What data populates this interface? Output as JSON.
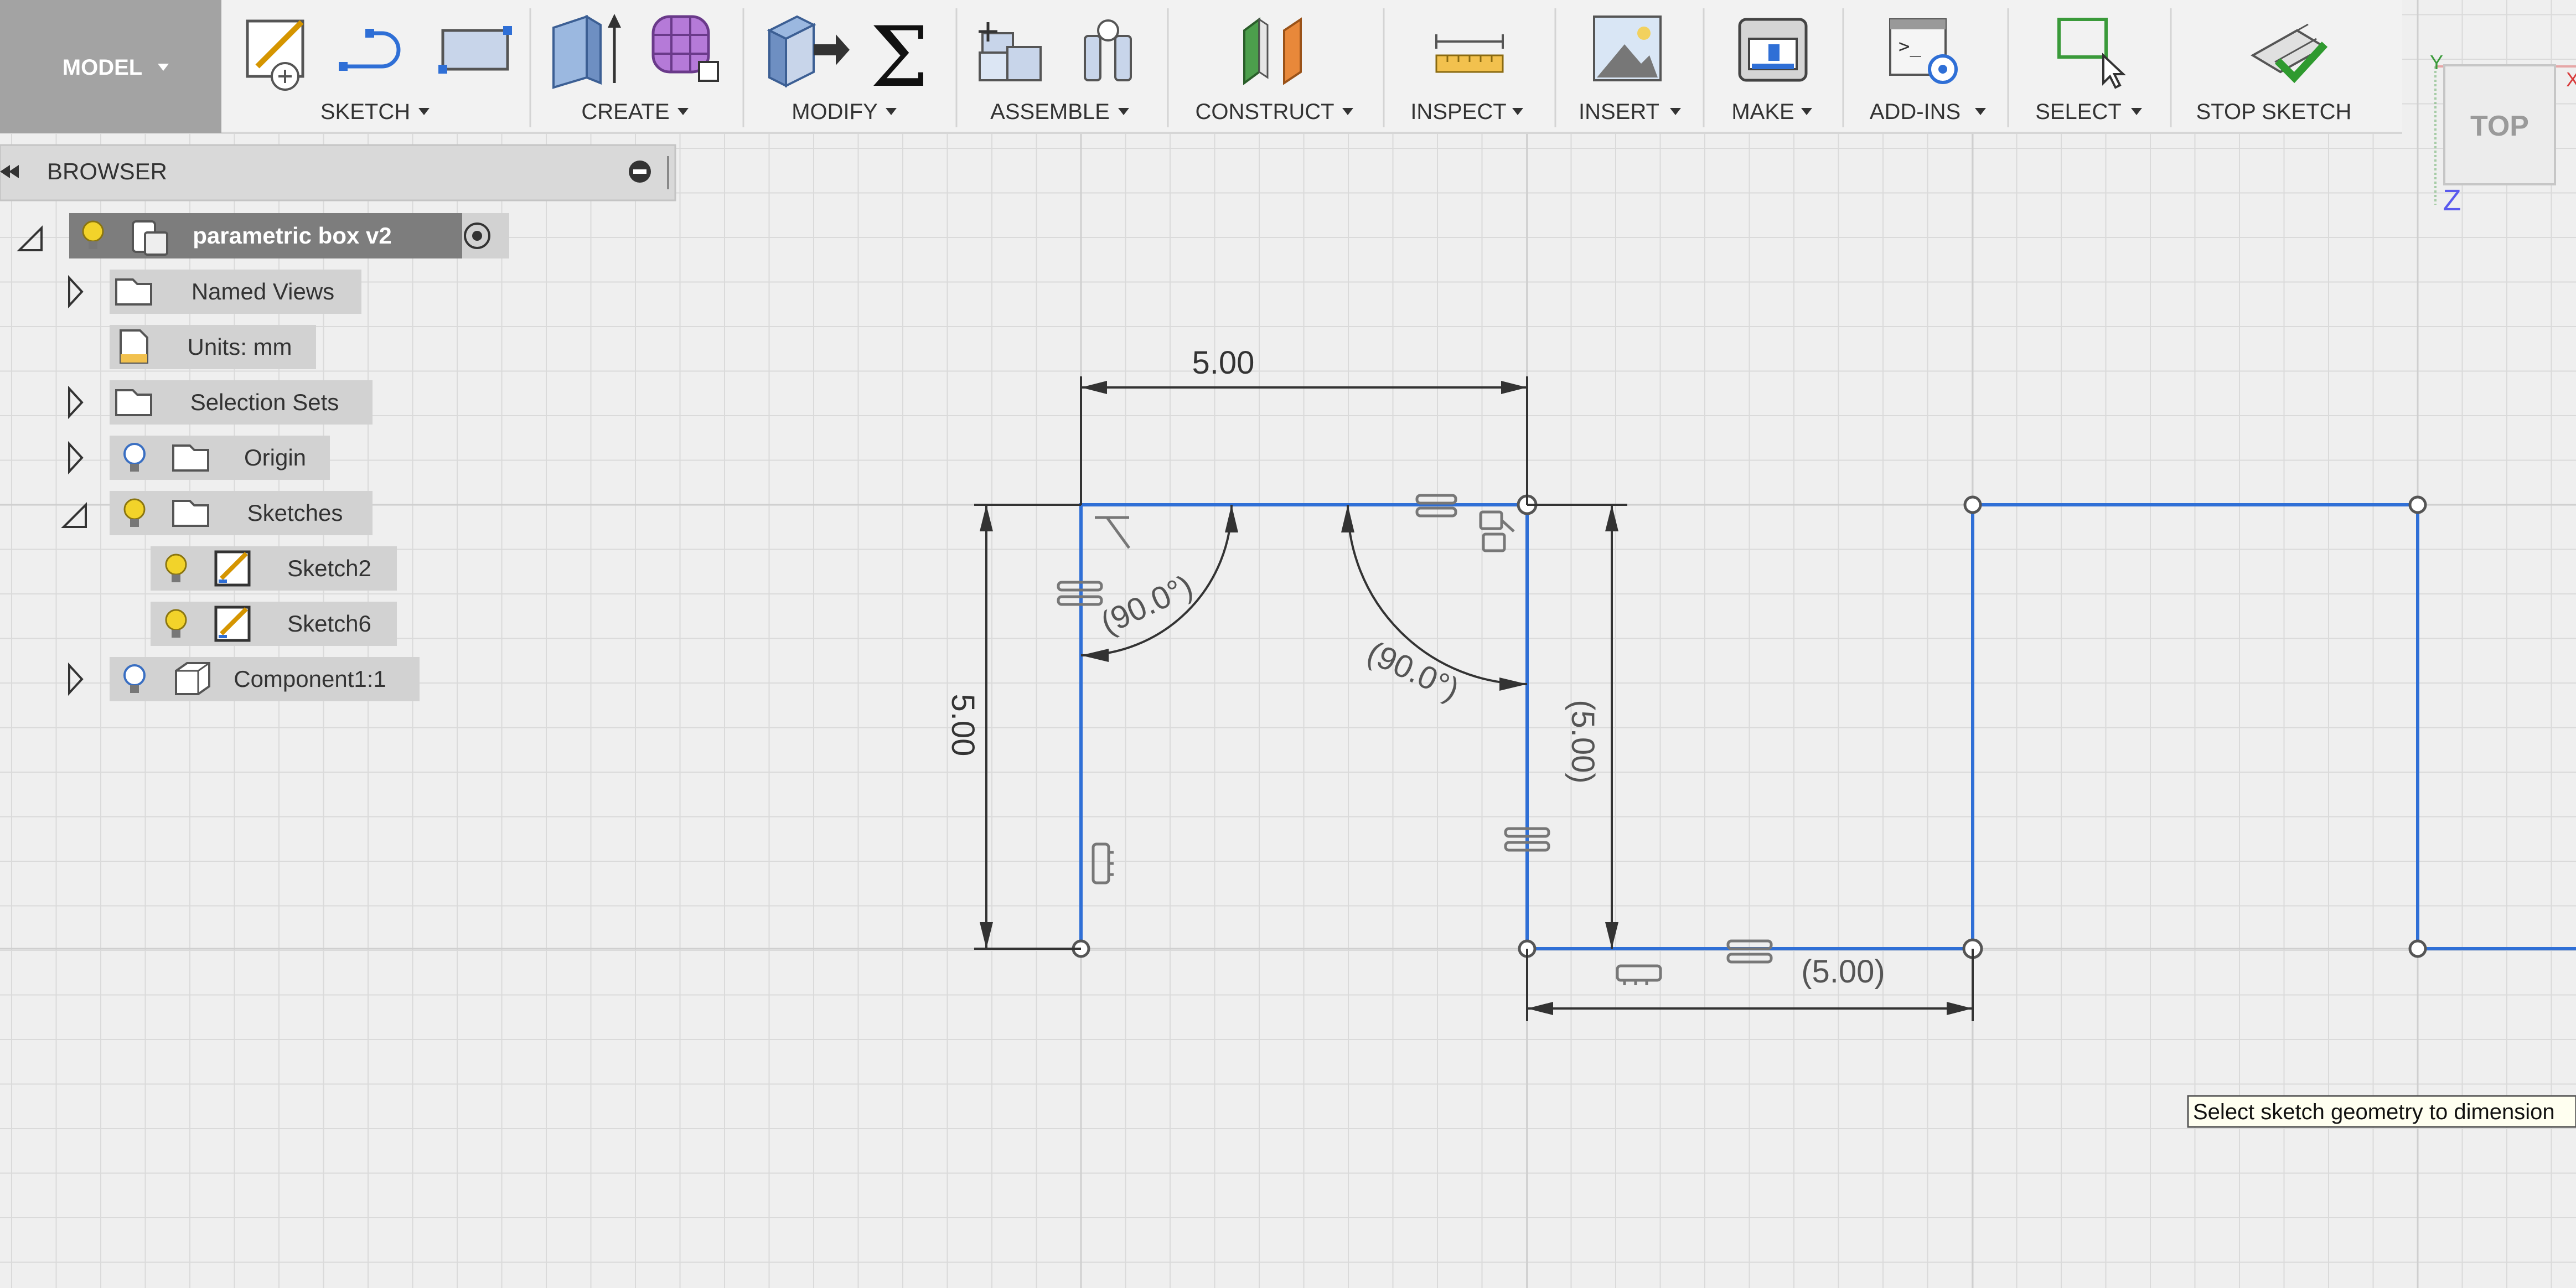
{
  "workspace": {
    "label": "MODEL"
  },
  "toolbar": {
    "groups": [
      {
        "label": "SKETCH"
      },
      {
        "label": "CREATE"
      },
      {
        "label": "MODIFY"
      },
      {
        "label": "ASSEMBLE"
      },
      {
        "label": "CONSTRUCT"
      },
      {
        "label": "INSPECT"
      },
      {
        "label": "INSERT"
      },
      {
        "label": "MAKE"
      },
      {
        "label": "ADD-INS"
      },
      {
        "label": "SELECT"
      },
      {
        "label": "STOP SKETCH"
      }
    ]
  },
  "browser": {
    "title": "BROWSER",
    "root": {
      "label": "parametric box v2"
    },
    "items": [
      {
        "label": "Named Views",
        "icon": "folder-icon"
      },
      {
        "label": "Units: mm",
        "icon": "document-icon"
      },
      {
        "label": "Selection Sets",
        "icon": "folder-icon"
      },
      {
        "label": "Origin",
        "icon": "folder-icon"
      },
      {
        "label": "Sketches",
        "icon": "folder-icon"
      },
      {
        "label": "Sketch2",
        "icon": "sketch-icon"
      },
      {
        "label": "Sketch6",
        "icon": "sketch-icon"
      },
      {
        "label": "Component1:1",
        "icon": "component-icon"
      }
    ]
  },
  "viewcube": {
    "face": "TOP",
    "axis_y": "Y",
    "axis_x": "X",
    "axis_z": "Z"
  },
  "dimensions": {
    "top_width": "5.00",
    "left_height": "5.00",
    "right_height": "(5.00)",
    "bottom_width": "(5.00)",
    "angle_left": "(90.0°)",
    "angle_right": "(90.0°)"
  },
  "tooltip": {
    "text": "Select sketch geometry to dimension"
  },
  "colors": {
    "sketch_line": "#2f6fd6",
    "canvas": "#efefef",
    "grid": "#dadada",
    "toolbar_bg": "#f2f2f2",
    "model_button": "#a3a3a3",
    "browser_header": "#d9d9d9",
    "browser_item_bg": "#d2d2d2",
    "browser_root_bg": "#7d7d7d"
  }
}
